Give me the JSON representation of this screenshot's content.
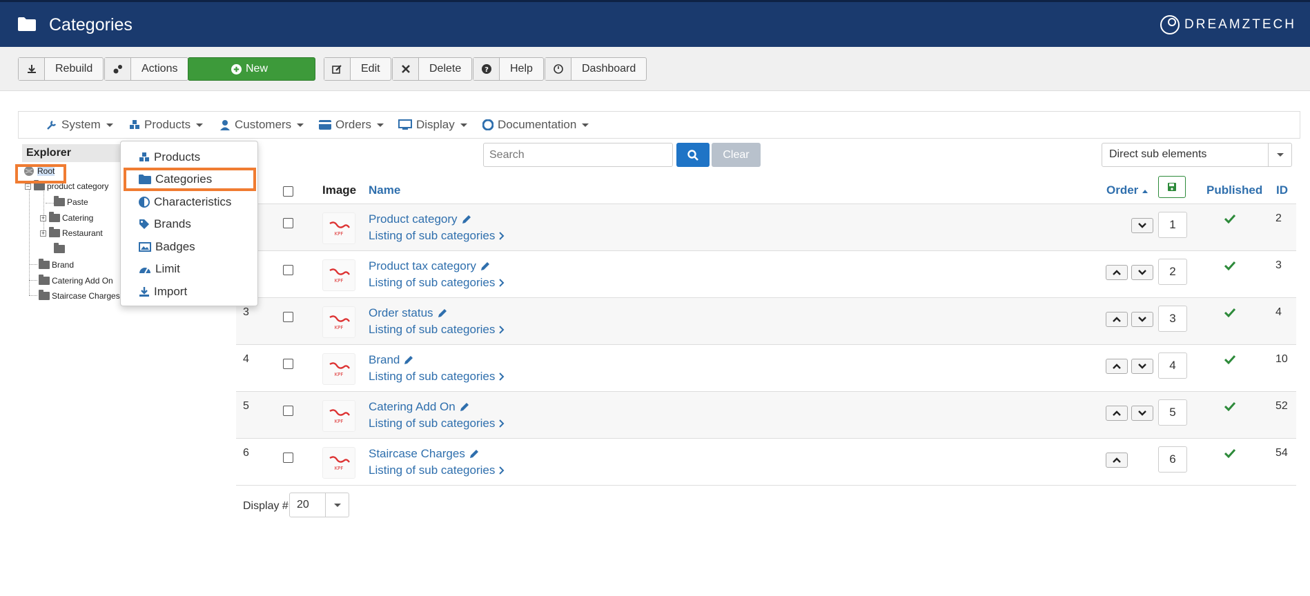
{
  "header": {
    "title": "Categories",
    "brand": "DREAMZTECH"
  },
  "toolbar": {
    "rebuild": "Rebuild",
    "actions": "Actions",
    "new": "New",
    "edit": "Edit",
    "delete": "Delete",
    "help": "Help",
    "dashboard": "Dashboard"
  },
  "menu": {
    "system": "System",
    "products": "Products",
    "customers": "Customers",
    "orders": "Orders",
    "display": "Display",
    "documentation": "Documentation"
  },
  "products_menu": {
    "items": [
      "Products",
      "Categories",
      "Characteristics",
      "Brands",
      "Badges",
      "Limit",
      "Import"
    ]
  },
  "explorer": {
    "title": "Explorer",
    "root": "Root",
    "nodes": [
      "product category",
      "Paste",
      "Catering",
      "Restaurant",
      "Brand",
      "Catering Add On",
      "Staircase Charges"
    ]
  },
  "search": {
    "placeholder": "Search",
    "clear": "Clear"
  },
  "filter": {
    "selected": "Direct sub elements"
  },
  "table": {
    "headers": {
      "image": "Image",
      "name": "Name",
      "order": "Order",
      "published": "Published",
      "id": "ID"
    },
    "sub_label": "Listing of sub categories",
    "rows": [
      {
        "num": "",
        "name": "Product category",
        "order": "1",
        "id": "2"
      },
      {
        "num": "",
        "name": "Product tax category",
        "order": "2",
        "id": "3"
      },
      {
        "num": "3",
        "name": "Order status",
        "order": "3",
        "id": "4"
      },
      {
        "num": "4",
        "name": "Brand",
        "order": "4",
        "id": "10"
      },
      {
        "num": "5",
        "name": "Catering Add On",
        "order": "5",
        "id": "52"
      },
      {
        "num": "6",
        "name": "Staircase Charges",
        "order": "6",
        "id": "54"
      }
    ]
  },
  "pagination": {
    "label": "Display #",
    "value": "20"
  },
  "colors": {
    "header_bg": "#1a3a6e",
    "link": "#2f6fad",
    "new_btn": "#3d9a3a",
    "search_btn": "#1f74c6",
    "highlight": "#f07c32",
    "published": "#2d8a3a"
  }
}
